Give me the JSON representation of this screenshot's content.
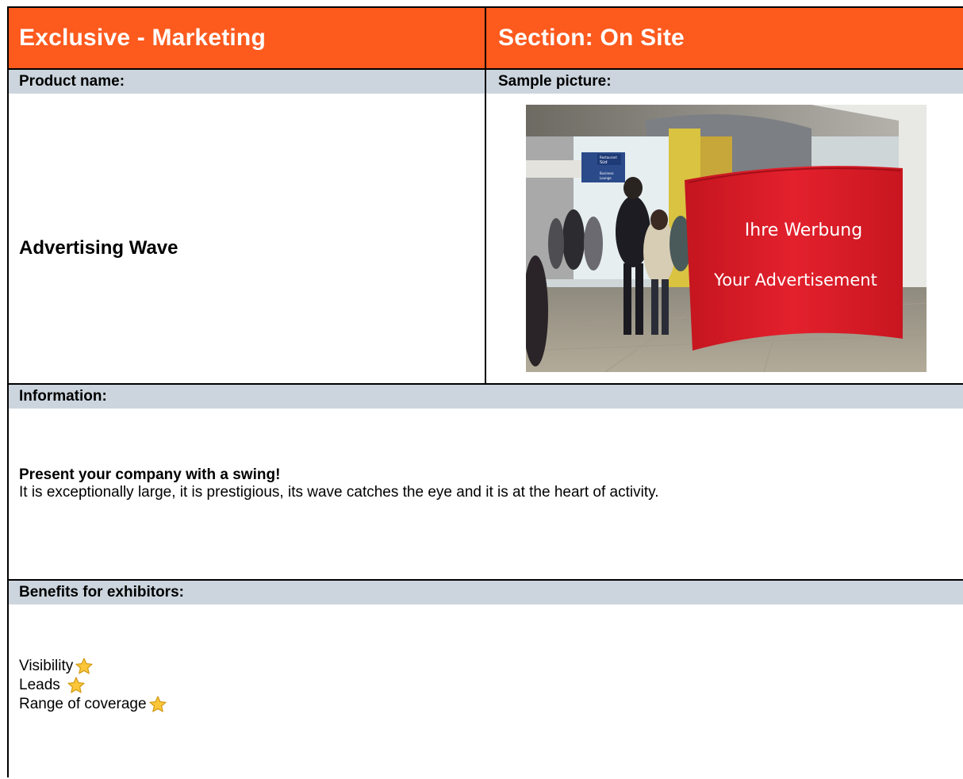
{
  "header": {
    "left_title": "Exclusive - Marketing",
    "right_title": "Section: On Site"
  },
  "labels": {
    "product_name": "Product name:",
    "sample_picture": "Sample picture:",
    "information": "Information:",
    "benefits": "Benefits for exhibitors:"
  },
  "product": {
    "name": "Advertising Wave",
    "photo": {
      "banner_line1": "Ihre Werbung",
      "banner_line2": "Your Advertisement",
      "sign_text_1": "Restaurant",
      "sign_text_2": "Süd",
      "sign_text_3": "Business",
      "sign_text_4": "Lounge"
    }
  },
  "information": {
    "heading": "Present your company with a swing!",
    "text": "It is exceptionally large, it is prestigious, its wave catches the eye and it is at the heart of activity."
  },
  "benefits": {
    "items": [
      {
        "label": "Visibility",
        "icon": "star-icon"
      },
      {
        "label": "Leads",
        "icon": "star-icon"
      },
      {
        "label": "Range of coverage",
        "icon": "star-icon"
      }
    ]
  },
  "colors": {
    "header_orange": "#fd5a1e",
    "label_grey": "#ccd5de",
    "banner_red": "#e0202f",
    "star_yellow": "#fcc63a"
  }
}
